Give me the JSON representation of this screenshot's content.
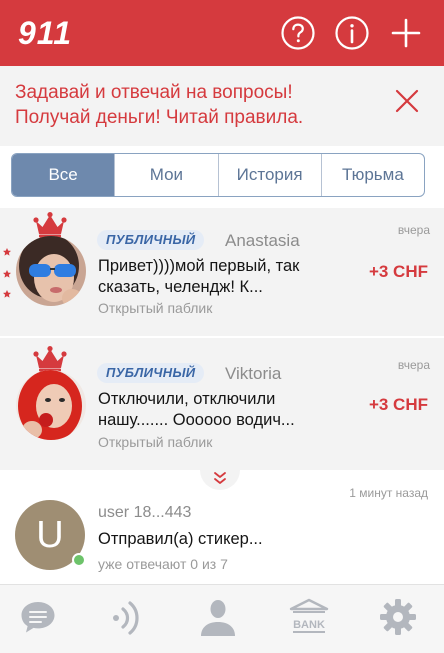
{
  "header": {
    "title": "911",
    "icons": [
      "help-icon",
      "info-icon",
      "plus-icon"
    ]
  },
  "banner": {
    "line1": "Задавай и отвечай на вопросы!",
    "line2": "Получай деньги! Читай правила."
  },
  "tabs": [
    {
      "label": "Все",
      "active": true
    },
    {
      "label": "Мои",
      "active": false
    },
    {
      "label": "История",
      "active": false
    },
    {
      "label": "Тюрьма",
      "active": false
    }
  ],
  "feed": [
    {
      "badge": "ПУБЛИЧНЫЙ",
      "author": "Anastasia",
      "time": "вчера",
      "message_line1": "Привет))))мой первый, так",
      "message_line2": "сказать, челендж! К...",
      "subtitle": "Открытый паблик",
      "price": "+3 CHF"
    },
    {
      "badge": "ПУБЛИЧНЫЙ",
      "author": "Viktoria",
      "time": "вчера",
      "message_line1": "Отключили, отключили",
      "message_line2": "нашу....... Оооооо водич...",
      "subtitle": "Открытый паблик",
      "price": "+3 CHF"
    },
    {
      "avatar_letter": "U",
      "author": "user 18...443",
      "time": "1 минут назад",
      "message": "Отправил(а) стикер...",
      "subtitle": "уже отвечают 0 из 7"
    }
  ],
  "tabbar": {
    "items": [
      "chat-icon",
      "broadcast-icon",
      "profile-icon",
      "bank-icon",
      "settings-icon"
    ],
    "bank_label": "BANK"
  },
  "colors": {
    "brand_red": "#d53a3e",
    "tab_active": "#6e89ad",
    "badge_blue": "#3a66a6",
    "online_green": "#6dc36a"
  }
}
